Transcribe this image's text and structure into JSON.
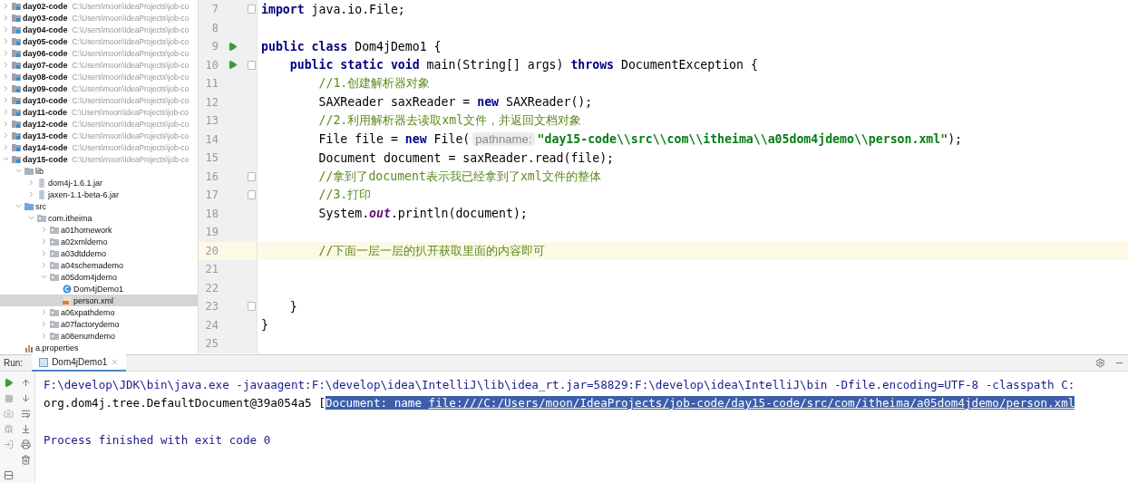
{
  "project_tree": [
    {
      "label": "day02-code",
      "path": "C:\\Users\\moon\\IdeaProjects\\job-co",
      "kind": "module",
      "expanded": false,
      "selected": false
    },
    {
      "label": "day03-code",
      "path": "C:\\Users\\moon\\IdeaProjects\\job-co",
      "kind": "module",
      "expanded": false,
      "selected": false
    },
    {
      "label": "day04-code",
      "path": "C:\\Users\\moon\\IdeaProjects\\job-co",
      "kind": "module",
      "expanded": false,
      "selected": false
    },
    {
      "label": "day05-code",
      "path": "C:\\Users\\moon\\IdeaProjects\\job-co",
      "kind": "module",
      "expanded": false,
      "selected": false
    },
    {
      "label": "day06-code",
      "path": "C:\\Users\\moon\\IdeaProjects\\job-co",
      "kind": "module",
      "expanded": false,
      "selected": false
    },
    {
      "label": "day07-code",
      "path": "C:\\Users\\moon\\IdeaProjects\\job-co",
      "kind": "module",
      "expanded": false,
      "selected": false
    },
    {
      "label": "day08-code",
      "path": "C:\\Users\\moon\\IdeaProjects\\job-co",
      "kind": "module",
      "expanded": false,
      "selected": false
    },
    {
      "label": "day09-code",
      "path": "C:\\Users\\moon\\IdeaProjects\\job-co",
      "kind": "module",
      "expanded": false,
      "selected": false
    },
    {
      "label": "day10-code",
      "path": "C:\\Users\\moon\\IdeaProjects\\job-co",
      "kind": "module",
      "expanded": false,
      "selected": false
    },
    {
      "label": "day11-code",
      "path": "C:\\Users\\moon\\IdeaProjects\\job-co",
      "kind": "module",
      "expanded": false,
      "selected": false
    },
    {
      "label": "day12-code",
      "path": "C:\\Users\\moon\\IdeaProjects\\job-co",
      "kind": "module",
      "expanded": false,
      "selected": false
    },
    {
      "label": "day13-code",
      "path": "C:\\Users\\moon\\IdeaProjects\\job-co",
      "kind": "module",
      "expanded": false,
      "selected": false
    },
    {
      "label": "day14-code",
      "path": "C:\\Users\\moon\\IdeaProjects\\job-co",
      "kind": "module",
      "expanded": false,
      "selected": false
    },
    {
      "label": "day15-code",
      "path": "C:\\Users\\moon\\IdeaProjects\\job-co",
      "kind": "module",
      "expanded": true,
      "selected": false,
      "children": [
        {
          "label": "lib",
          "kind": "folder",
          "expanded": true,
          "selected": false,
          "children": [
            {
              "label": "dom4j-1.6.1.jar",
              "kind": "jar",
              "expanded": false,
              "selected": false
            },
            {
              "label": "jaxen-1.1-beta-6.jar",
              "kind": "jar",
              "expanded": false,
              "selected": false
            }
          ]
        },
        {
          "label": "src",
          "kind": "source",
          "expanded": true,
          "selected": false,
          "children": [
            {
              "label": "com.itheima",
              "kind": "package",
              "expanded": true,
              "selected": false,
              "children": [
                {
                  "label": "a01homework",
                  "kind": "package",
                  "expanded": false,
                  "selected": false
                },
                {
                  "label": "a02xmldemo",
                  "kind": "package",
                  "expanded": false,
                  "selected": false
                },
                {
                  "label": "a03dtddemo",
                  "kind": "package",
                  "expanded": false,
                  "selected": false
                },
                {
                  "label": "a04schemademo",
                  "kind": "package",
                  "expanded": false,
                  "selected": false
                },
                {
                  "label": "a05dom4jdemo",
                  "kind": "package",
                  "expanded": true,
                  "selected": false,
                  "children": [
                    {
                      "label": "Dom4jDemo1",
                      "kind": "class",
                      "selected": false
                    },
                    {
                      "label": "person.xml",
                      "kind": "xml",
                      "selected": true
                    }
                  ]
                },
                {
                  "label": "a06xpathdemo",
                  "kind": "package",
                  "expanded": false,
                  "selected": false
                },
                {
                  "label": "a07factorydemo",
                  "kind": "package",
                  "expanded": false,
                  "selected": false
                },
                {
                  "label": "a08enumdemo",
                  "kind": "package",
                  "expanded": false,
                  "selected": false
                }
              ]
            }
          ]
        },
        {
          "label": "a.properties",
          "kind": "properties",
          "selected": false
        }
      ]
    }
  ],
  "editor": {
    "lines": [
      {
        "number": "7",
        "run": false,
        "fold": true,
        "current": false,
        "tokens": [
          {
            "kind": "keyword",
            "text": "import"
          },
          {
            "kind": "plain",
            "text": " java.io.File;"
          }
        ]
      },
      {
        "number": "8",
        "run": false,
        "fold": false,
        "current": false
      },
      {
        "number": "9",
        "run": true,
        "fold": false,
        "current": false,
        "tokens": [
          {
            "kind": "keyword",
            "text": "public class"
          },
          {
            "kind": "plain",
            "text": " Dom4jDemo1 {"
          }
        ]
      },
      {
        "number": "10",
        "run": true,
        "fold": true,
        "current": false,
        "tokens": [
          {
            "kind": "keyword",
            "text": "    public static void"
          },
          {
            "kind": "plain",
            "text": " main(String[] args) "
          },
          {
            "kind": "keyword",
            "text": "throws"
          },
          {
            "kind": "plain",
            "text": " DocumentException {"
          }
        ]
      },
      {
        "number": "11",
        "run": false,
        "fold": false,
        "current": false,
        "tokens": [
          {
            "kind": "comment",
            "text": "        //1.创建解析器对象"
          }
        ]
      },
      {
        "number": "12",
        "run": false,
        "fold": false,
        "current": false,
        "tokens": [
          {
            "kind": "plain",
            "text": "        SAXReader saxReader = "
          },
          {
            "kind": "keyword",
            "text": "new"
          },
          {
            "kind": "plain",
            "text": " SAXReader();"
          }
        ]
      },
      {
        "number": "13",
        "run": false,
        "fold": false,
        "current": false,
        "tokens": [
          {
            "kind": "comment",
            "text": "        //2.利用解析器去读取xml文件，并返回文档对象"
          }
        ]
      },
      {
        "number": "14",
        "run": false,
        "fold": false,
        "current": false,
        "tokens": [
          {
            "kind": "plain",
            "text": "        File file = "
          },
          {
            "kind": "keyword",
            "text": "new"
          },
          {
            "kind": "plain",
            "text": " File("
          },
          {
            "kind": "hint",
            "text": "pathname:"
          },
          {
            "kind": "string",
            "text": "\"day15-code\\\\src\\\\com\\\\itheima\\\\a05dom4jdemo\\\\person.xml\""
          },
          {
            "kind": "plain",
            "text": ");"
          }
        ]
      },
      {
        "number": "15",
        "run": false,
        "fold": false,
        "current": false,
        "tokens": [
          {
            "kind": "plain",
            "text": "        Document document = saxReader.read(file);"
          }
        ]
      },
      {
        "number": "16",
        "run": false,
        "fold": true,
        "current": false,
        "tokens": [
          {
            "kind": "comment",
            "text": "        //拿到了document表示我已经拿到了xml文件的整体"
          }
        ]
      },
      {
        "number": "17",
        "run": false,
        "fold": true,
        "current": false,
        "tokens": [
          {
            "kind": "comment",
            "text": "        //3.打印"
          }
        ]
      },
      {
        "number": "18",
        "run": false,
        "fold": false,
        "current": false,
        "tokens": [
          {
            "kind": "plain",
            "text": "        System."
          },
          {
            "kind": "field",
            "text": "out"
          },
          {
            "kind": "plain",
            "text": ".println(document);"
          }
        ]
      },
      {
        "number": "19",
        "run": false,
        "fold": false,
        "current": false
      },
      {
        "number": "20",
        "run": false,
        "fold": false,
        "current": true,
        "tokens": [
          {
            "kind": "comment",
            "text": "        //下面一层一层的扒开获取里面的内容即可"
          }
        ]
      },
      {
        "number": "21",
        "run": false,
        "fold": false,
        "current": false
      },
      {
        "number": "22",
        "run": false,
        "fold": false,
        "current": false
      },
      {
        "number": "23",
        "run": false,
        "fold": true,
        "current": false,
        "tokens": [
          {
            "kind": "plain",
            "text": "    }"
          }
        ]
      },
      {
        "number": "24",
        "run": false,
        "fold": false,
        "current": false,
        "tokens": [
          {
            "kind": "plain",
            "text": "}"
          }
        ]
      },
      {
        "number": "25",
        "run": false,
        "fold": false,
        "current": false
      }
    ]
  },
  "run_panel": {
    "label": "Run:",
    "tab": {
      "label": "Dom4jDemo1"
    },
    "console": [
      {
        "kind": "system",
        "segments": [
          {
            "kind": "plain",
            "text": "F:\\develop\\JDK\\bin\\java.exe -javaagent:F:\\develop\\idea\\IntelliJ\\lib\\idea_rt.jar=58829:F:\\develop\\idea\\IntelliJ\\bin -Dfile.encoding=UTF-8 -classpath C:"
          }
        ]
      },
      {
        "kind": "output",
        "segments": [
          {
            "kind": "plain",
            "text": "org.dom4j.tree.DefaultDocument@39a054a5 ["
          },
          {
            "kind": "selected",
            "text": "Document: name "
          },
          {
            "kind": "selected-link",
            "text": "file:///C:/Users/moon/IdeaProjects/job-code/day15-code/src/com/itheima/a05dom4jdemo/person.xml"
          }
        ]
      },
      {
        "kind": "blank"
      },
      {
        "kind": "system",
        "segments": [
          {
            "kind": "plain",
            "text": "Process finished with exit code 0"
          }
        ]
      }
    ]
  }
}
